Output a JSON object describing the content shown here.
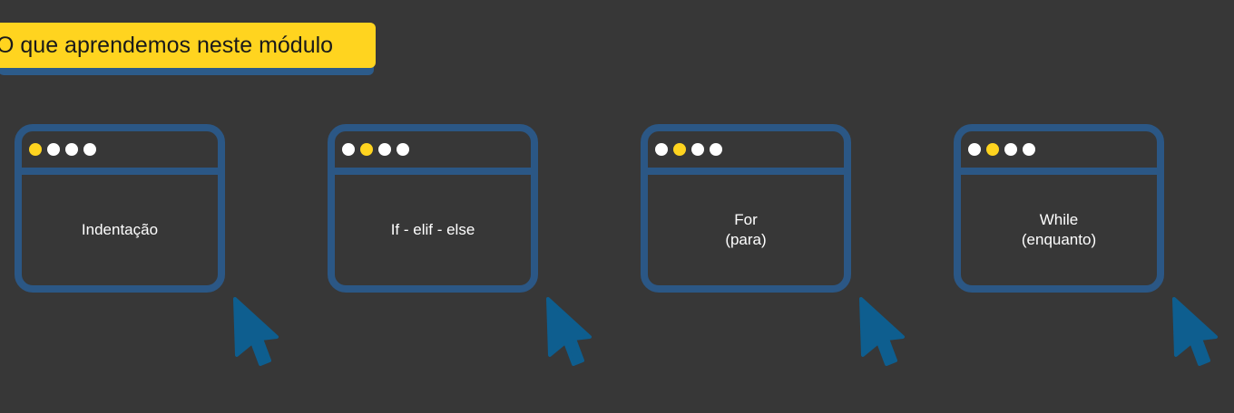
{
  "title": "O que aprendemos neste módulo",
  "colors": {
    "background": "#373737",
    "frame": "#2b5785",
    "accent": "#ffd41f",
    "cursor": "#0e5e8f"
  },
  "cards": [
    {
      "label": "Indentação",
      "active_dot": 1,
      "cursor_icon": "cursor-arrow-icon"
    },
    {
      "label": "If - elif - else",
      "active_dot": 2,
      "cursor_icon": "cursor-arrow-icon"
    },
    {
      "label": "For\n(para)",
      "active_dot": 2,
      "cursor_icon": "cursor-arrow-icon"
    },
    {
      "label": "While\n(enquanto)",
      "active_dot": 2,
      "cursor_icon": "cursor-arrow-icon"
    }
  ]
}
